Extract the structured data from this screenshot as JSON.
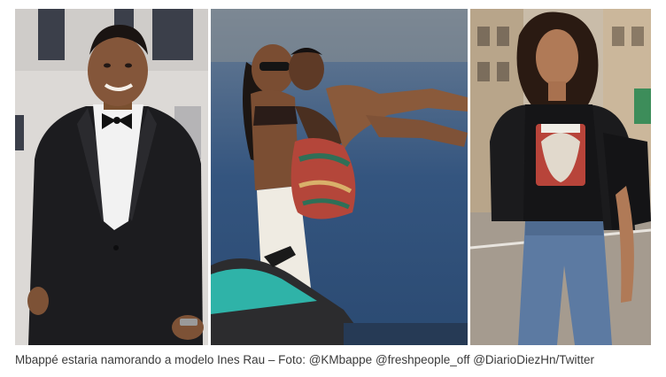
{
  "caption": "Mbappé estaria namorando a modelo Ines Rau – Foto: @KMbappe @freshpeople_off @DiarioDiezHn/Twitter",
  "colors": {
    "panel1_backdrop": "#d9d6d3",
    "panel2_sea": "#2f4d78",
    "panel3_street": "#b9aa95",
    "tuxedo": "#1b1b1d",
    "jetski_teal": "#2fb3a8"
  }
}
